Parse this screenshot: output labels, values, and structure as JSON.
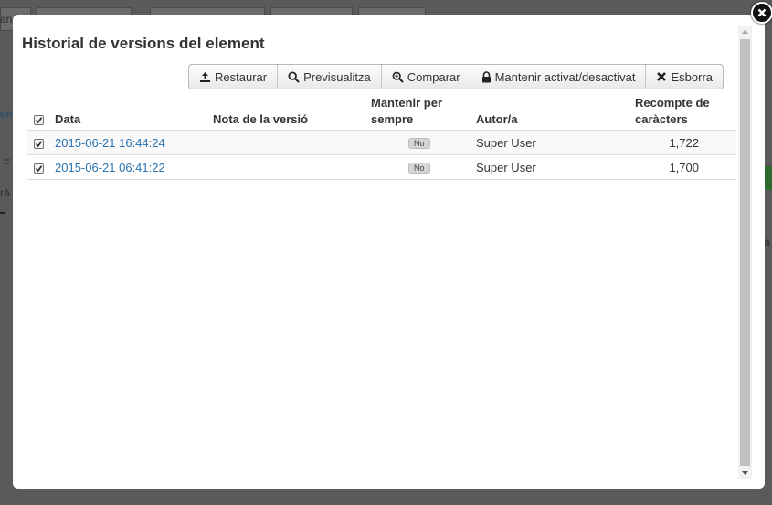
{
  "modal": {
    "title": "Historial de versions del element"
  },
  "toolbar": {
    "restore": "Restaurar",
    "preview": "Previsualitza",
    "compare": "Comparar",
    "keep_toggle": "Mantenir activat/desactivat",
    "delete": "Esborra"
  },
  "table": {
    "headers": {
      "date": "Data",
      "note": "Nota de la versió",
      "keep_line1": "Mantenir per",
      "keep_line2": "sempre",
      "author": "Autor/a",
      "chars_line1": "Recompte de",
      "chars_line2": "caràcters"
    },
    "rows": [
      {
        "date": "2015-06-21 16:44:24",
        "note": "",
        "keep": "No",
        "author": "Super User",
        "chars": "1,722",
        "checked": true
      },
      {
        "date": "2015-06-21 06:41:22",
        "note": "",
        "keep": "No",
        "author": "Super User",
        "chars": "1,700",
        "checked": true
      }
    ]
  },
  "background": {
    "frag1": "and",
    "frag2": "ent",
    "frag3": "F",
    "frag4": "rà",
    "frag5": "a"
  }
}
